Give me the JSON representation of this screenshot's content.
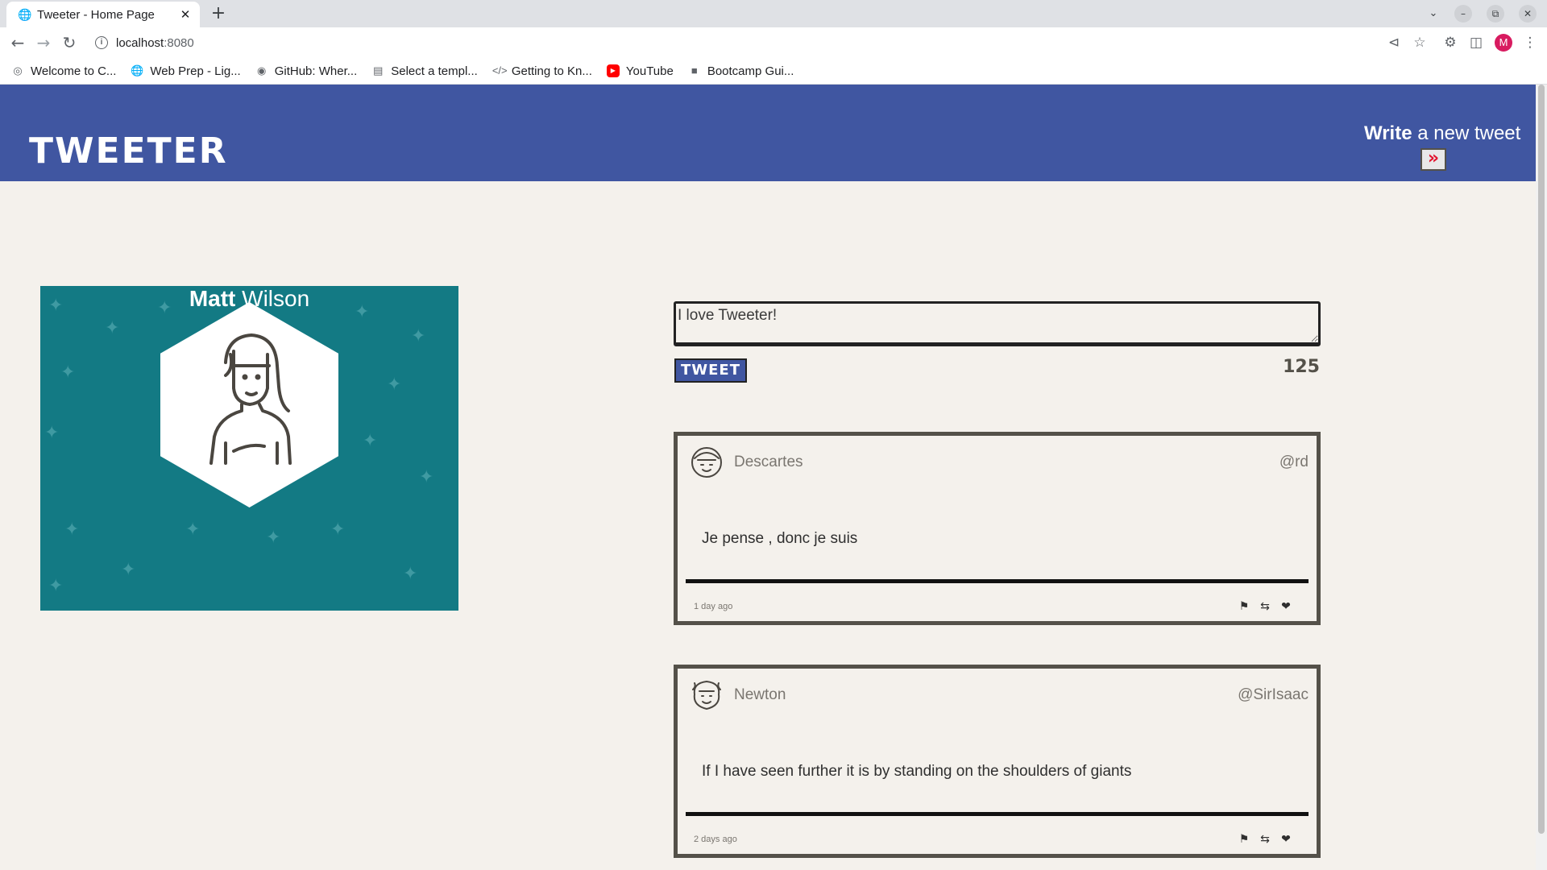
{
  "browser": {
    "tab_title": "Tweeter - Home Page",
    "url_host": "localhost",
    "url_port": ":8080",
    "bookmarks": [
      {
        "label": "Welcome to C...",
        "icon": "globe-icon"
      },
      {
        "label": "Web Prep - Lig...",
        "icon": "globe-icon"
      },
      {
        "label": "GitHub: Wher...",
        "icon": "github-icon"
      },
      {
        "label": "Select a templ...",
        "icon": "doc-icon"
      },
      {
        "label": "Getting to Kn...",
        "icon": "code-icon"
      },
      {
        "label": "YouTube",
        "icon": "youtube-icon"
      },
      {
        "label": "Bootcamp Gui...",
        "icon": "folder-icon"
      }
    ],
    "profile_initial": "M"
  },
  "header": {
    "logo": "TWEETER",
    "write_bold": "Write",
    "write_rest": " a new tweet"
  },
  "profile": {
    "first_name": "Matt",
    "last_name": " Wilson"
  },
  "composer": {
    "value": "I love Tweeter!",
    "button_label": "TWEET",
    "counter": "125"
  },
  "tweets": [
    {
      "name": "Descartes",
      "handle": "@rd",
      "text": "Je pense , donc je suis",
      "date": "1 day ago"
    },
    {
      "name": "Newton",
      "handle": "@SirIsaac",
      "text": "If I have seen further it is by standing on the shoulders of giants",
      "date": "2 days ago"
    }
  ],
  "colors": {
    "header_bg": "#4056a1",
    "profile_bg": "#137a84",
    "page_bg": "#f4f1ec",
    "toggle_arrow": "#e2142f",
    "border": "#545149"
  }
}
